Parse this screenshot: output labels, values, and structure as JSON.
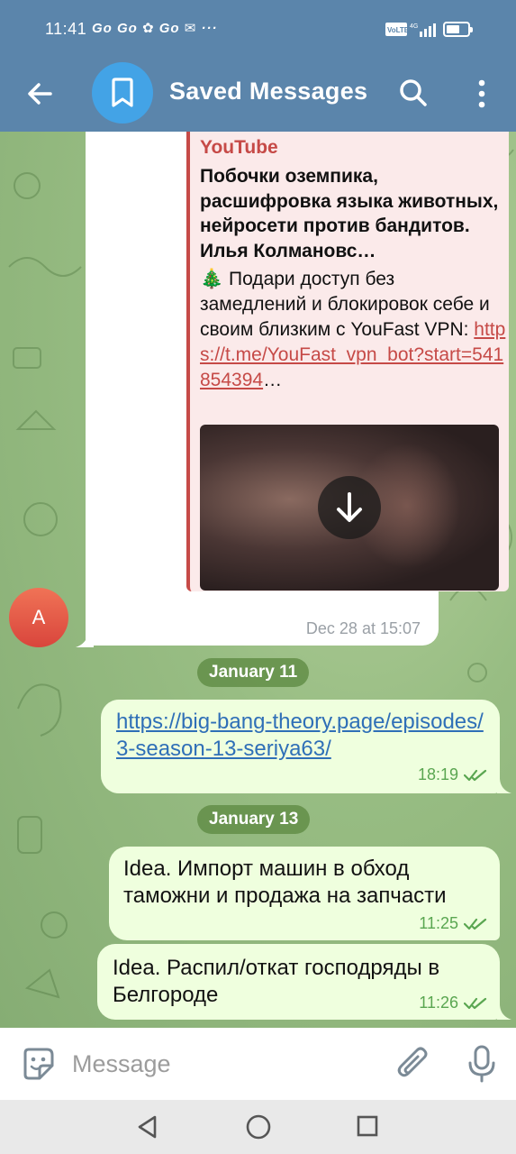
{
  "status_bar": {
    "time": "11:41",
    "notifications": "Go Go ✿ Go ✉ ···",
    "network": "VoLTE 4G"
  },
  "header": {
    "title": "Saved Messages"
  },
  "messages": {
    "youtube": {
      "site_name": "YouTube",
      "title": "Побочки оземпика, расшифровка языка животных, нейросети против бандитов. Илья Колмановс…",
      "desc_emoji": "🎄",
      "desc_text": "Подари доступ без замедлений и блокировок себе и своим близким с YouFast VPN: ",
      "desc_link": "https://t.me/YouFast_vpn_bot?start=541854394",
      "desc_ellipsis": "…",
      "time": "Dec 28 at 15:07",
      "sender_initial": "A"
    },
    "date_jan11": "January 11",
    "link_msg": {
      "text": "https://big-bang-theory.page/episodes/3-season-13-seriya63/",
      "time": "18:19"
    },
    "date_jan13": "January 13",
    "idea1": {
      "text": "Idea. Импорт машин в обход таможни и продажа на запчасти",
      "time": "11:25"
    },
    "idea2": {
      "text": "Idea. Распил/откат господряды в Белгороде",
      "time": "11:26"
    }
  },
  "input": {
    "placeholder": "Message"
  },
  "colors": {
    "header": "#5b85ab",
    "accent_link": "#2f6fb7",
    "youtube_red": "#c64a47",
    "out_bubble": "#efffde",
    "check": "#5aa651"
  },
  "icons": {
    "back": "back-arrow-icon",
    "saved": "bookmark-icon",
    "search": "search-icon",
    "more": "more-vertical-icon",
    "download": "download-icon",
    "emoji": "sticker-icon",
    "attach": "paperclip-icon",
    "mic": "microphone-icon"
  }
}
